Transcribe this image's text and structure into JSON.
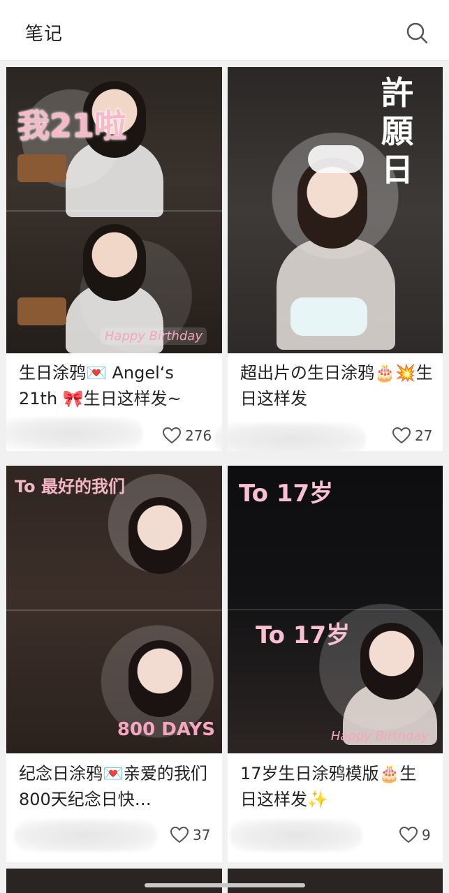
{
  "header": {
    "title": "笔记"
  },
  "cards": [
    {
      "title": "生日涂鸦💌 Angel‘s 21th 🎀生日这样发~",
      "likes": "276",
      "image_text": {
        "headline": "我21啦",
        "corner": "Happy Birthday"
      }
    },
    {
      "title": "超出片の生日涂鸦🎂💥生日这样发",
      "likes": "27",
      "image_text": {
        "headline": "許願日"
      }
    },
    {
      "title": "纪念日涂鸦💌亲爱的我们 800天纪念日快…",
      "likes": "37",
      "image_text": {
        "headline": "To 最好的我们",
        "corner": "800 DAYS"
      }
    },
    {
      "title": "17岁生日涂鸦模版🎂生日这样发✨",
      "likes": "9",
      "image_text": {
        "headline": "To 17岁",
        "headline2": "To 17岁",
        "corner": "Happy Birthday"
      }
    }
  ],
  "icons": {
    "search": "search-icon",
    "like": "heart-outline-icon"
  }
}
